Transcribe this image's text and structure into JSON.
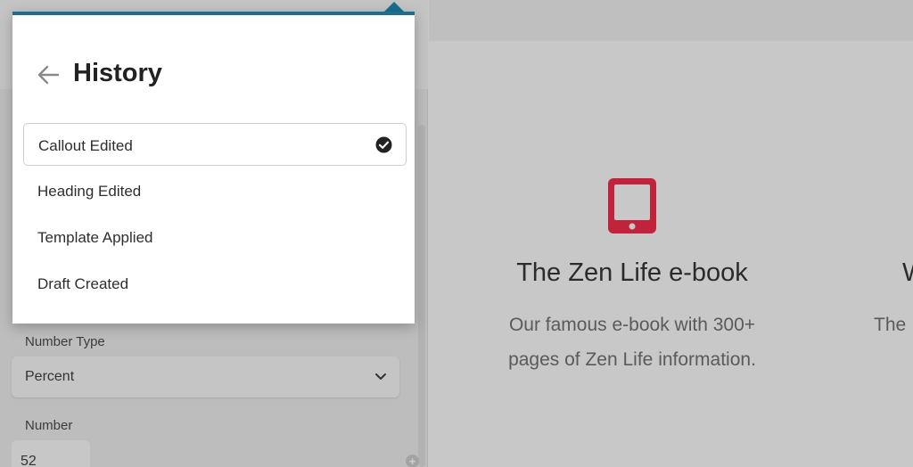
{
  "history_panel": {
    "title": "History",
    "items": [
      {
        "label": "Callout Edited",
        "active": true
      },
      {
        "label": "Heading Edited",
        "active": false
      },
      {
        "label": "Template Applied",
        "active": false
      },
      {
        "label": "Draft Created",
        "active": false
      }
    ]
  },
  "sidebar": {
    "number_type_label": "Number Type",
    "number_type_value": "Percent",
    "number_label": "Number",
    "number_value": "52",
    "add_icon": "plus-circle-icon"
  },
  "preview": {
    "card1": {
      "icon": "tablet-icon",
      "icon_color": "#c0243c",
      "title": "The Zen Life e-book",
      "description_line1": "Our famous e-book with 300+",
      "description_line2": "pages of Zen Life information."
    },
    "card2": {
      "title": "W",
      "description": "The"
    }
  },
  "colors": {
    "accent": "#1a6e8f",
    "overlay": "#c9c9c9"
  }
}
